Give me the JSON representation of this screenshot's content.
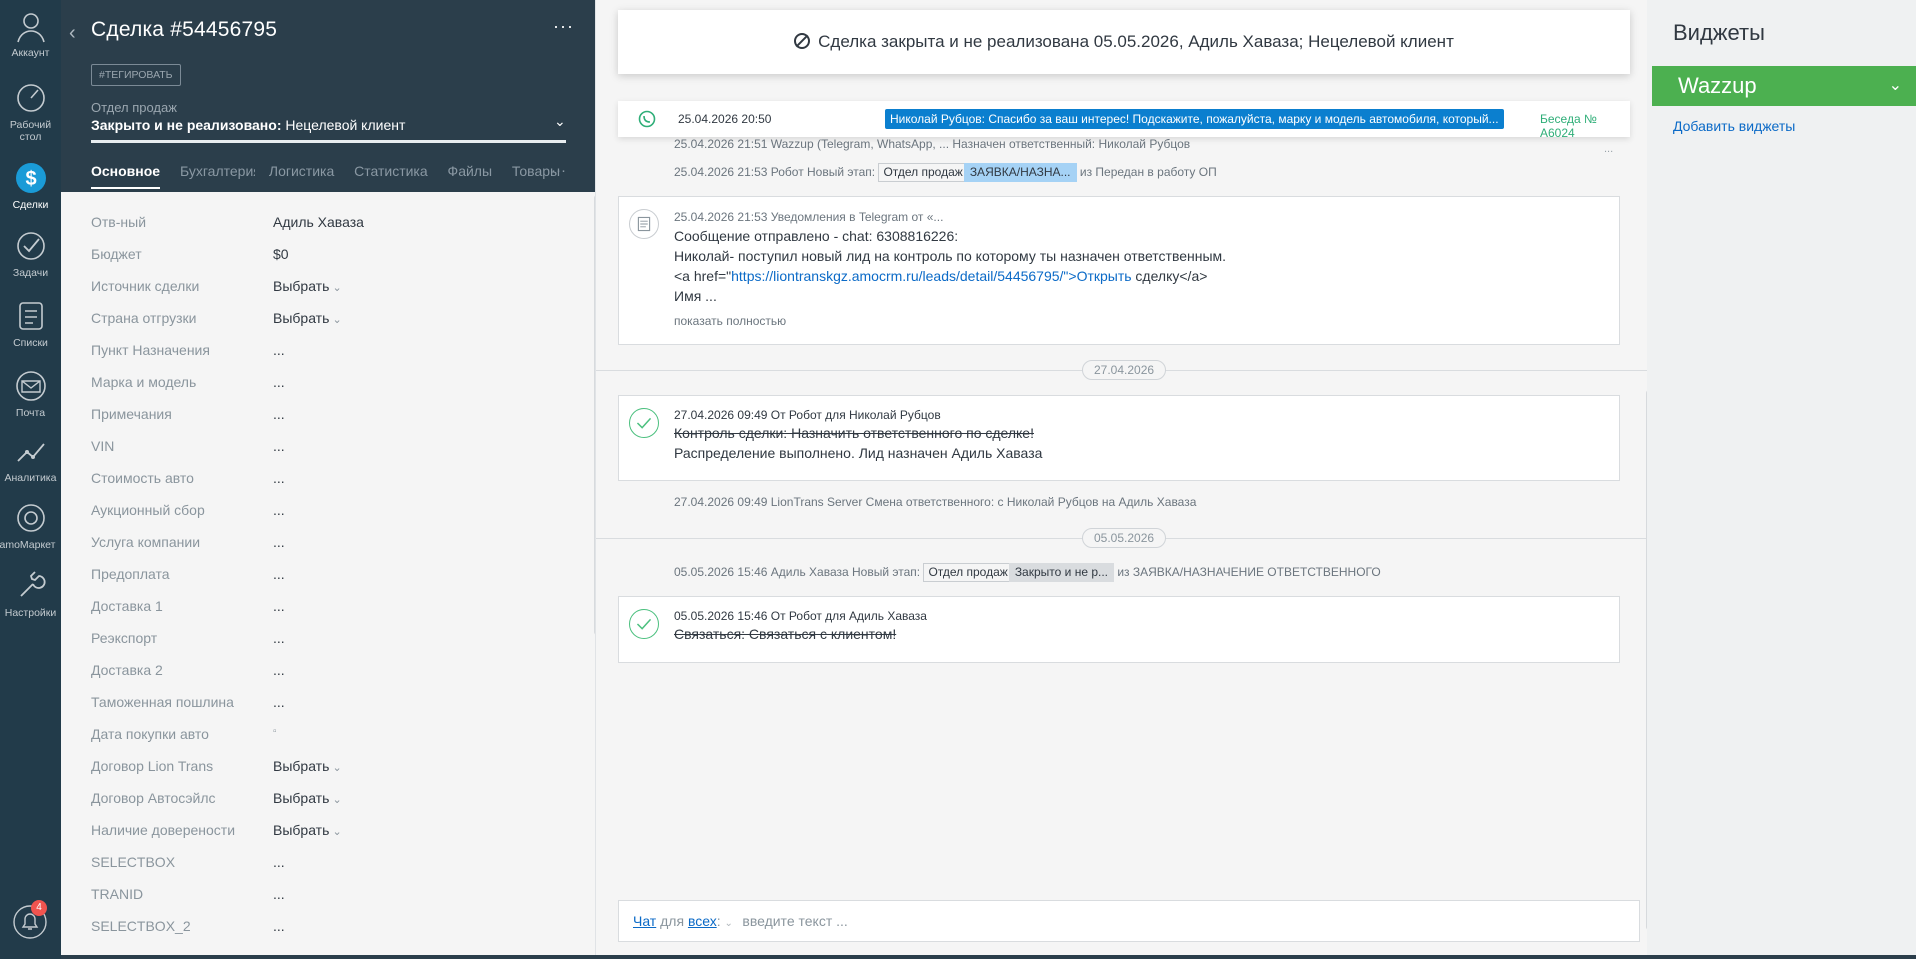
{
  "nav": {
    "items": [
      {
        "label": "Аккаунт",
        "icon": "user-icon"
      },
      {
        "label": "Рабочий стол",
        "icon": "dashboard-icon"
      },
      {
        "label": "Сделки",
        "icon": "dollar-icon"
      },
      {
        "label": "Задачи",
        "icon": "check-icon"
      },
      {
        "label": "Списки",
        "icon": "list-icon"
      },
      {
        "label": "Почта",
        "icon": "mail-icon"
      },
      {
        "label": "Аналитика",
        "icon": "analytics-icon"
      },
      {
        "label": "amoМаркет",
        "icon": "market-icon"
      },
      {
        "label": "Настройки",
        "icon": "settings-icon"
      }
    ],
    "notif_badge": "4"
  },
  "card": {
    "title": "Сделка #54456795",
    "tag_button": "#ТЕГИРОВАТЬ",
    "pipeline_label": "Отдел продаж",
    "status_prefix": "Закрыто и не реализовано:",
    "status_reason": "Нецелевой клиент",
    "tabs": [
      "Основное",
      "Бухгалтерия",
      "Логистика",
      "Статистика",
      "Файлы",
      "Товары"
    ],
    "fields": [
      {
        "label": "Отв-ный",
        "value": "Адиль Хаваза",
        "type": "text"
      },
      {
        "label": "Бюджет",
        "value": "$0",
        "type": "text"
      },
      {
        "label": "Источник сделки",
        "value": "Выбрать",
        "type": "select"
      },
      {
        "label": "Страна отгрузки",
        "value": "Выбрать",
        "type": "select"
      },
      {
        "label": "Пункт Назначения",
        "value": "...",
        "type": "text"
      },
      {
        "label": "Марка и модель",
        "value": "...",
        "type": "text"
      },
      {
        "label": "Примечания",
        "value": "...",
        "type": "text"
      },
      {
        "label": "VIN",
        "value": "...",
        "type": "text"
      },
      {
        "label": "Стоимость авто",
        "value": "...",
        "type": "text"
      },
      {
        "label": "Аукционный сбор",
        "value": "...",
        "type": "text"
      },
      {
        "label": "Услуга компании",
        "value": "...",
        "type": "text"
      },
      {
        "label": "Предоплата",
        "value": "...",
        "type": "text"
      },
      {
        "label": "Доставка 1",
        "value": "...",
        "type": "text"
      },
      {
        "label": "Реэкспорт",
        "value": "...",
        "type": "text"
      },
      {
        "label": "Доставка 2",
        "value": "...",
        "type": "text"
      },
      {
        "label": "Таможенная пошлина",
        "value": "...",
        "type": "text"
      },
      {
        "label": "Дата покупки авто",
        "value": "▫",
        "type": "date"
      },
      {
        "label": "Договор Lion Trans",
        "value": "Выбрать",
        "type": "select"
      },
      {
        "label": "Договор Автосэйлс",
        "value": "Выбрать",
        "type": "select"
      },
      {
        "label": "Наличие доверености",
        "value": "Выбрать",
        "type": "select"
      },
      {
        "label": "SELECTBOX",
        "value": "...",
        "type": "text"
      },
      {
        "label": "TRANID",
        "value": "...",
        "type": "text"
      },
      {
        "label": "SELECTBOX_2",
        "value": "...",
        "type": "text"
      }
    ]
  },
  "feed": {
    "toast": "Сделка закрыта и не реализована 05.05.2026, Адиль Хаваза; Нецелевой клиент",
    "chat_notice": {
      "time": "25.04.2026 20:50",
      "message": "Николай Рубцов: Спасибо за ваш интерес! Подскажите, пожалуйста, марку и модель автомобиля, который...",
      "conversation": "Беседа № А6024"
    },
    "ev1": "25.04.2026 21:51 Wazzup (Telegram, WhatsApp, ... Назначен ответственный: Николай Рубцов",
    "ev2": {
      "prefix": "25.04.2026 21:53 Робот Новый этап:",
      "pipe": "Отдел продаж",
      "stage": "ЗАЯВКА/НАЗНА...",
      "suffix": "из Передан в работу ОП"
    },
    "note1": {
      "meta": "25.04.2026 21:53 Уведомления в Telegram от «...",
      "line1": "Сообщение отправлено - chat: 6308816226:",
      "line2": "Николай- поступил новый лид на контроль по которому ты назначен ответственным.",
      "line3_pre": "<a href=\"",
      "line3_link": "https://liontranskgz.amocrm.ru/leads/detail/54456795/\">Открыть",
      "line3_post": " сделку</a>",
      "line4": "Имя ...",
      "more": "показать полностью"
    },
    "date1": "27.04.2026",
    "note2": {
      "meta": "27.04.2026 09:49  От Робот для Николай Рубцов",
      "line1": "Контроль сделки: Назначить ответственного по сделке!",
      "line2": "Распределение выполнено. Лид назначен Адиль Хаваза"
    },
    "ev3": "27.04.2026 09:49 LionTrans Server Смена ответственного: с Николай Рубцов на Адиль Хаваза",
    "date2": "05.05.2026",
    "ev4": {
      "prefix": "05.05.2026 15:46 Адиль Хаваза Новый этап:",
      "pipe": "Отдел продаж",
      "stage": "Закрыто и не р...",
      "suffix": "из ЗАЯВКА/НАЗНАЧЕНИЕ ОТВЕТСТВЕННОГО"
    },
    "note3": {
      "meta": "05.05.2026 15:46  От Робот для Адиль Хаваза",
      "line1": "Связаться: Связаться с клиентом!"
    },
    "chat_box": {
      "chat_link": "Чат",
      "for_text": " для ",
      "all_link": "всех",
      "placeholder": "введите текст ..."
    }
  },
  "widgets": {
    "title": "Виджеты",
    "wazzup": "Wazzup",
    "add": "Добавить виджеты"
  },
  "colors": {
    "nav_bg": "#223b4a",
    "card_head_bg": "#2b3e4b",
    "wazzup_green": "#4cb050",
    "message_blue": "#0b7fcf"
  }
}
